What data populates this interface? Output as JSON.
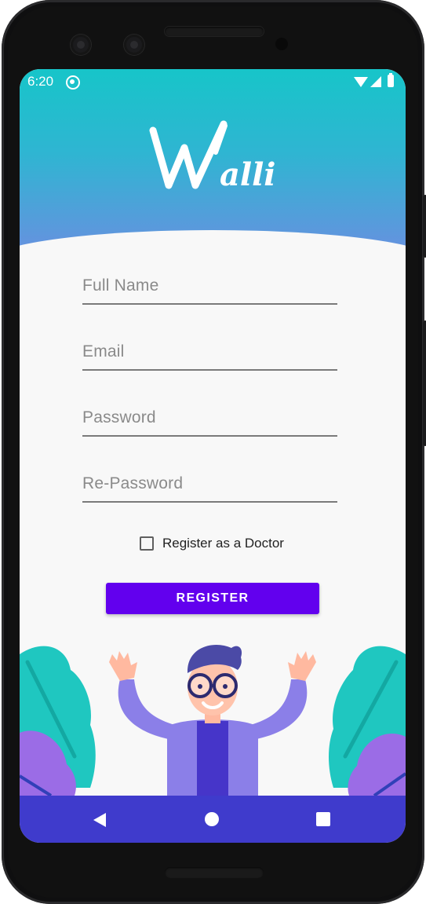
{
  "status_bar": {
    "time": "6:20"
  },
  "app": {
    "logo_text": "Walli"
  },
  "form": {
    "full_name_placeholder": "Full Name",
    "email_placeholder": "Email",
    "password_placeholder": "Password",
    "repassword_placeholder": "Re-Password",
    "doctor_checkbox_label": "Register as a Doctor",
    "doctor_checkbox_checked": false,
    "register_button_label": "REGISTER"
  },
  "colors": {
    "header_top": "#17c5c9",
    "header_bottom": "#6a8fe0",
    "button": "#6200ee",
    "nav_bar": "#3f3bcc"
  },
  "icons": [
    "wifi-icon",
    "signal-icon",
    "battery-icon",
    "back-icon",
    "home-icon",
    "recents-icon"
  ]
}
